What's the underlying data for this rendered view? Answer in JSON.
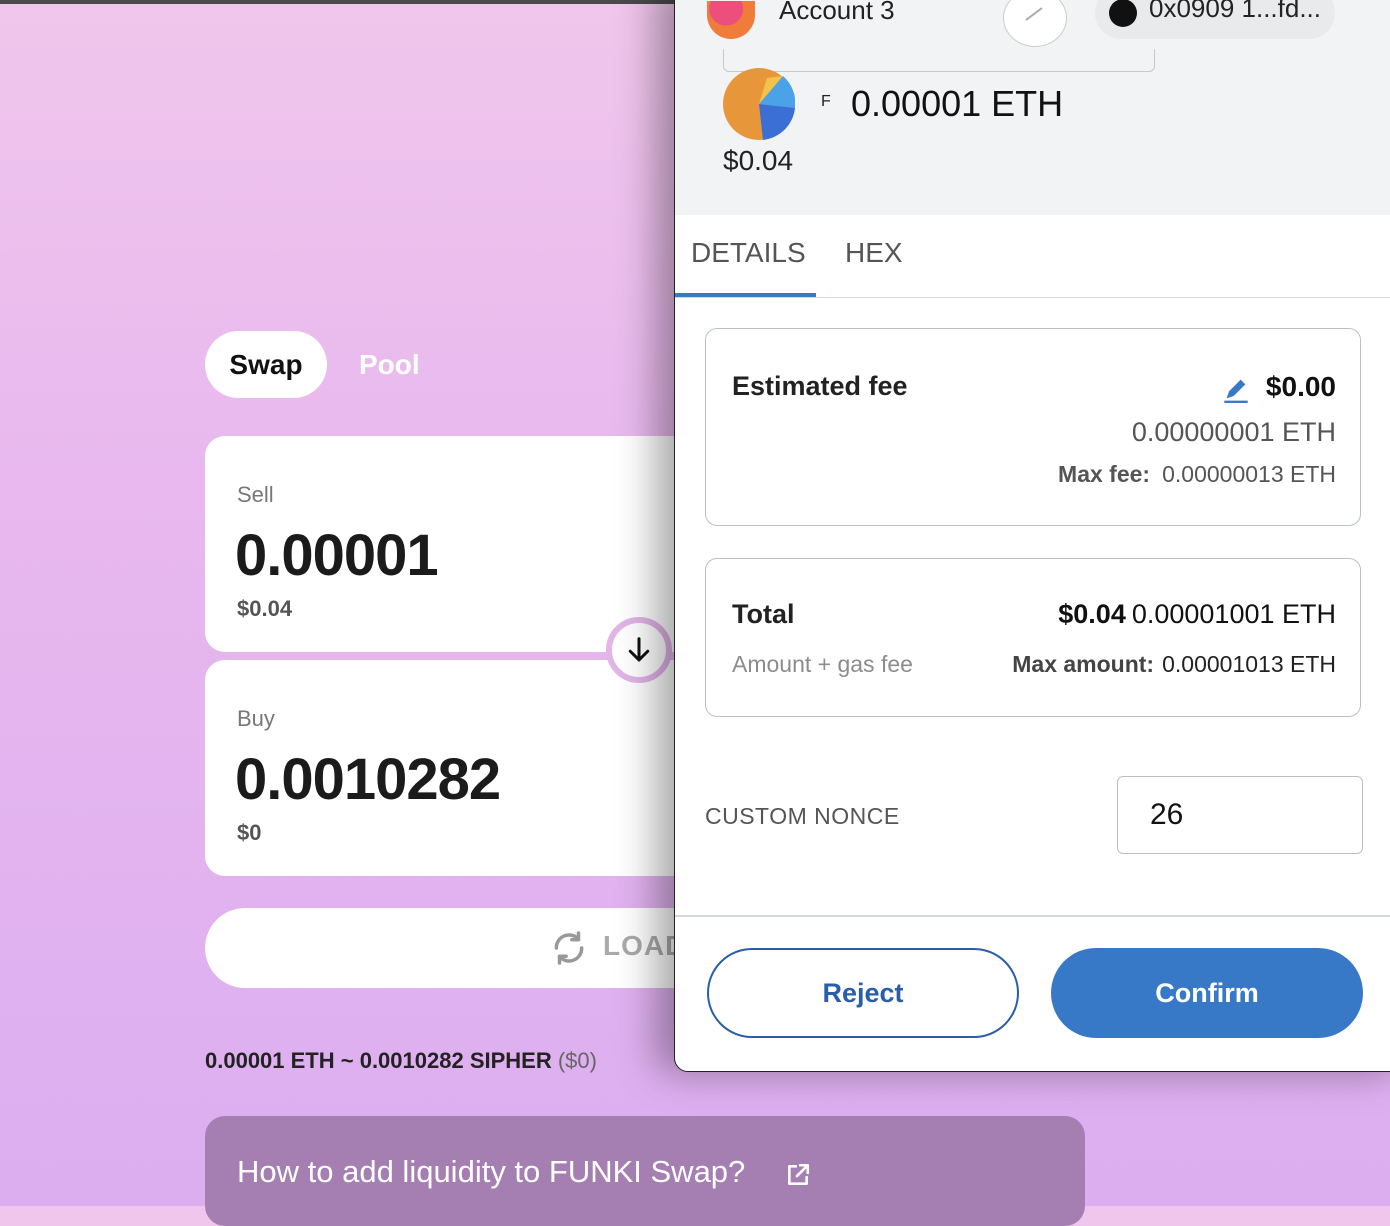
{
  "dapp": {
    "tabs": {
      "swap": "Swap",
      "pool": "Pool"
    },
    "sell": {
      "label": "Sell",
      "amount": "0.00001",
      "usd": "$0.04"
    },
    "buy": {
      "label": "Buy",
      "amount": "0.0010282",
      "usd": "$0"
    },
    "loading_label": "LOAD",
    "rate": {
      "text": "0.00001 ETH ~ 0.0010282 SIPHER",
      "usd": "($0)"
    },
    "help_link": "How to add liquidity to FUNKI Swap?"
  },
  "popup": {
    "account_name": "Account 3",
    "address": "0x0909 1...fd...",
    "token": {
      "letter": "F",
      "amount": "0.00001 ETH",
      "usd": "$0.04"
    },
    "tabs": {
      "details": "DETAILS",
      "hex": "HEX"
    },
    "estimated_fee": {
      "label": "Estimated fee",
      "usd": "$0.00",
      "eth": "0.00000001 ETH",
      "max_fee_label": "Max fee:",
      "max_fee_value": "0.00000013 ETH"
    },
    "total": {
      "label": "Total",
      "sub_label": "Amount + gas fee",
      "usd": "$0.04",
      "eth": "0.00001001 ETH",
      "max_amount_label": "Max amount:",
      "max_amount_value": "0.00001013 ETH"
    },
    "nonce": {
      "label": "CUSTOM NONCE",
      "value": "26"
    },
    "buttons": {
      "reject": "Reject",
      "confirm": "Confirm"
    }
  },
  "colors": {
    "accent": "#3779c6",
    "reject_border": "#2a5ea8",
    "help_bg": "#a57fb2"
  }
}
